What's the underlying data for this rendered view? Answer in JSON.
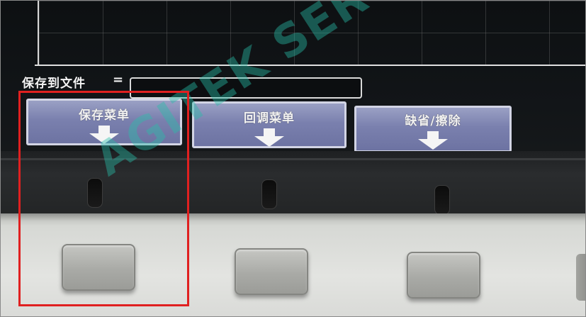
{
  "screen": {
    "save_to_file_label": "保存到文件",
    "equals_sign": "=",
    "filename_value": ""
  },
  "softkeys": [
    {
      "label": "保存菜单",
      "icon": "arrow-down-icon"
    },
    {
      "label": "回调菜单",
      "icon": "arrow-down-icon"
    },
    {
      "label": "缺省/擦除",
      "icon": "arrow-down-icon"
    }
  ],
  "watermark": "AGITEK SERVICE",
  "colors": {
    "softkey": "#7a80ae",
    "highlight": "#e02020",
    "watermark": "#28beaa"
  }
}
